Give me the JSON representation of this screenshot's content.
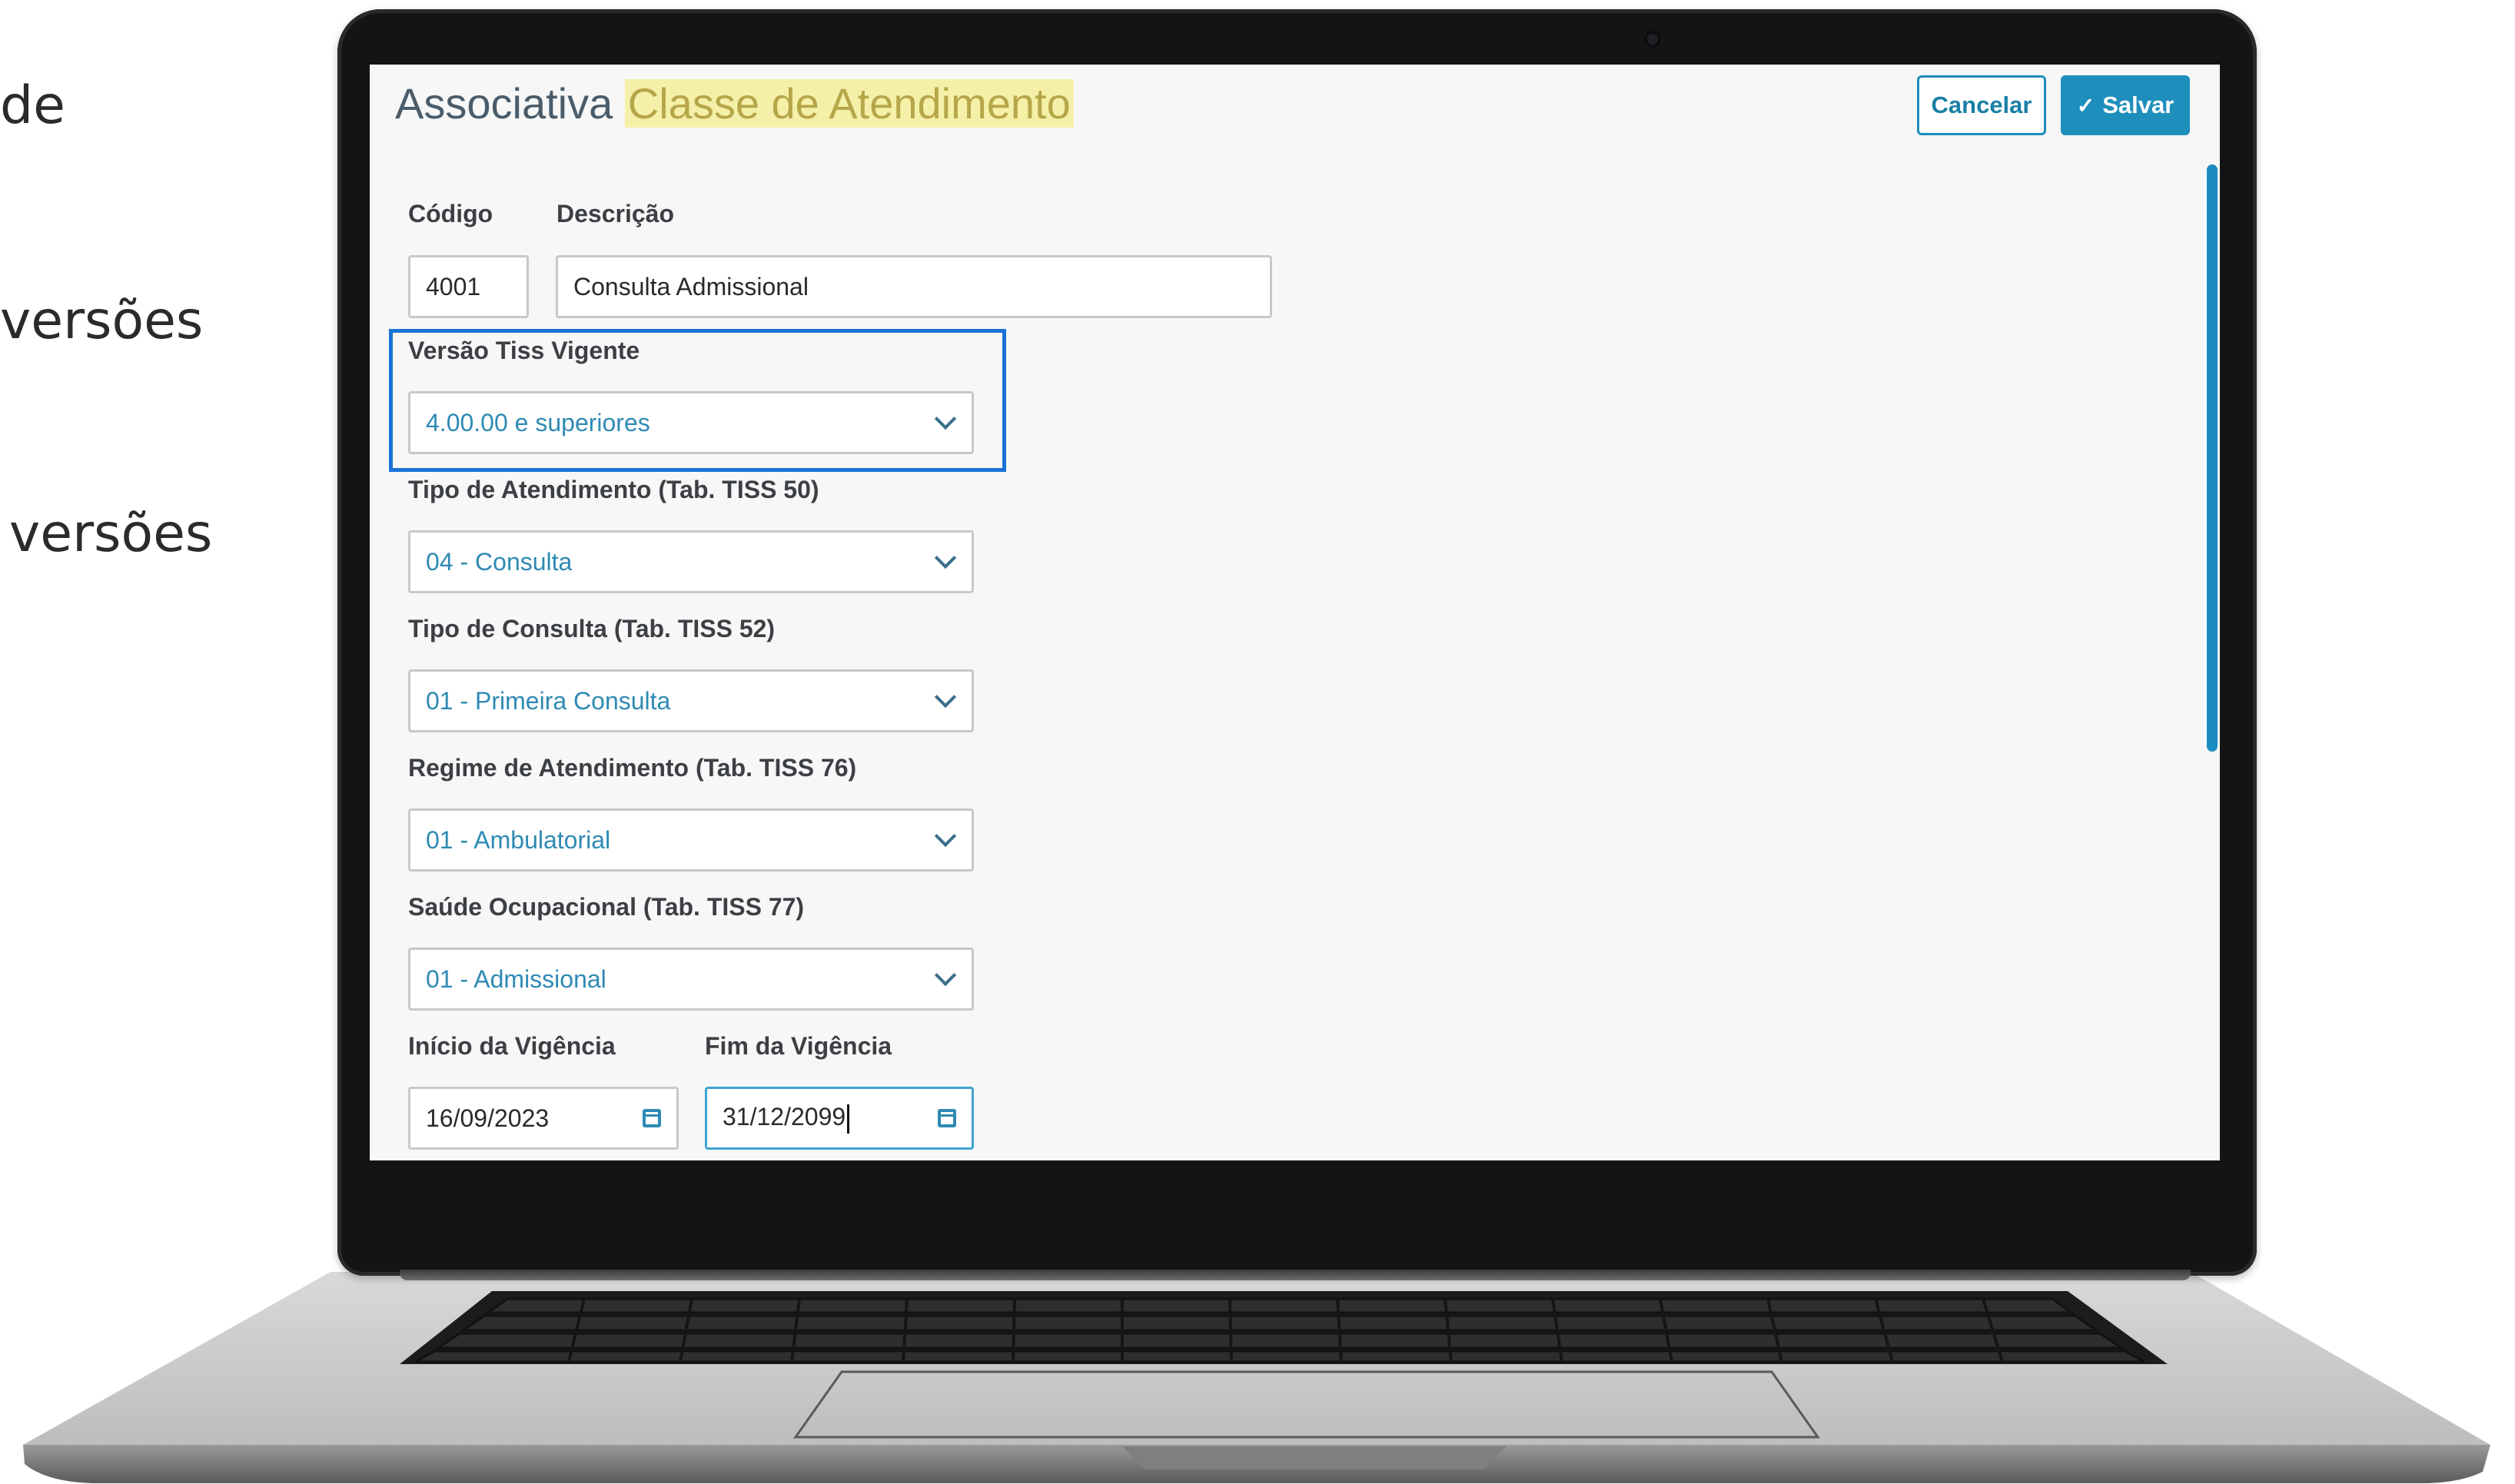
{
  "slide": {
    "fragments": [
      "de",
      "versões",
      "versões"
    ]
  },
  "header": {
    "title_prefix": "Associativa",
    "title_highlight": "Classe de Atendimento",
    "cancel_label": "Cancelar",
    "save_label": "Salvar"
  },
  "form": {
    "codigo": {
      "label": "Código",
      "value": "4001"
    },
    "descricao": {
      "label": "Descrição",
      "value": "Consulta Admissional"
    },
    "versao_tiss": {
      "label": "Versão Tiss Vigente",
      "value": "4.00.00 e superiores"
    },
    "tipo_atendimento": {
      "label": "Tipo de Atendimento (Tab. TISS 50)",
      "value": "04 - Consulta"
    },
    "tipo_consulta": {
      "label": "Tipo de Consulta (Tab. TISS 52)",
      "value": "01 - Primeira Consulta"
    },
    "regime_atendimento": {
      "label": "Regime de Atendimento (Tab. TISS 76)",
      "value": "01 - Ambulatorial"
    },
    "saude_ocupacional": {
      "label": "Saúde Ocupacional (Tab. TISS 77)",
      "value": "01 - Admissional"
    },
    "inicio_vigencia": {
      "label": "Início da Vigência",
      "value": "16/09/2023"
    },
    "fim_vigencia": {
      "label": "Fim da Vigência",
      "value": "31/12/2099"
    }
  },
  "colors": {
    "primary": "#1e8fbd",
    "highlight_border": "#1a73d6",
    "title_highlight_bg": "#f5f0a8",
    "select_text": "#2f8ab4"
  },
  "icons": {
    "save": "check-icon",
    "select": "chevron-down-icon",
    "date": "calendar-icon"
  }
}
